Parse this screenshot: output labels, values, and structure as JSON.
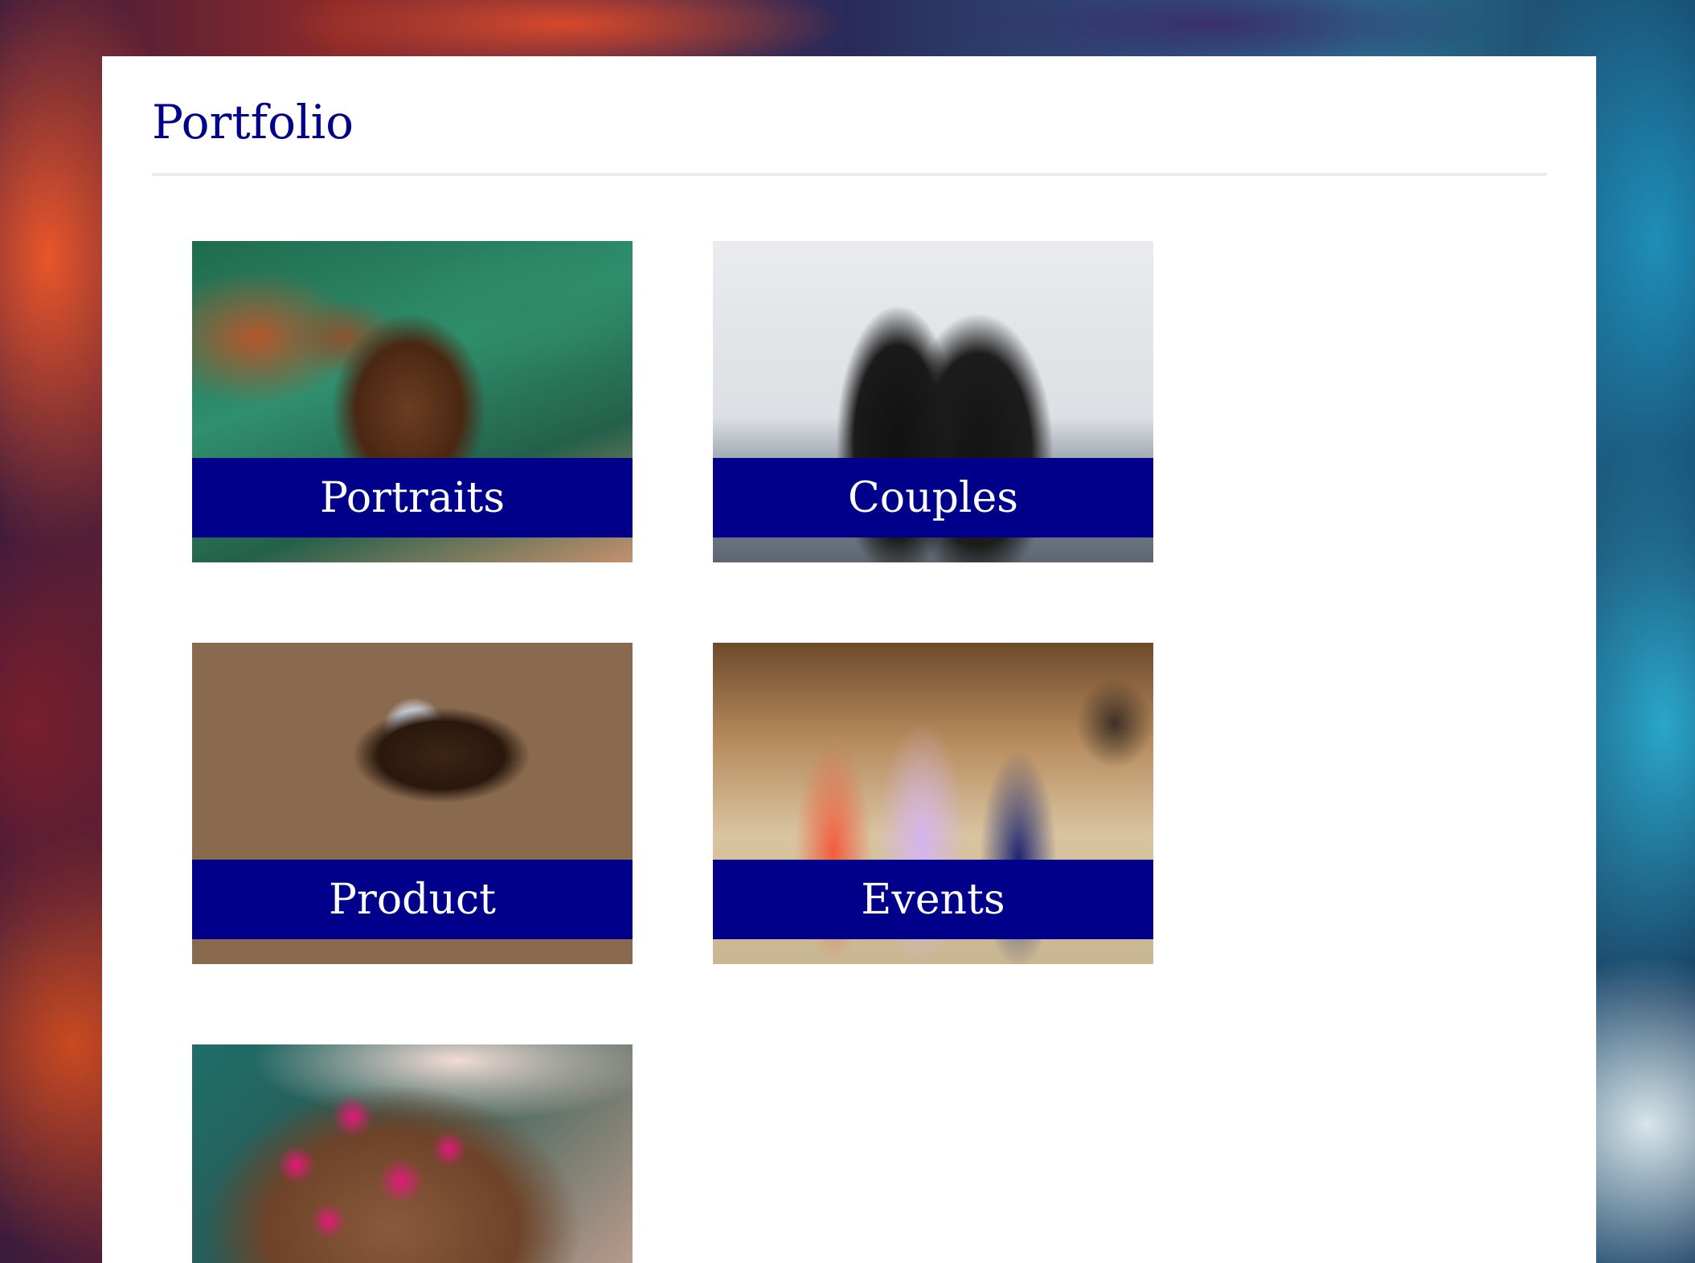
{
  "page": {
    "title": "Portfolio"
  },
  "gallery": {
    "tiles": [
      {
        "label": "Portraits",
        "photo": "portrait-photo"
      },
      {
        "label": "Couples",
        "photo": "couple-photo"
      },
      {
        "label": "Product",
        "photo": "product-photo"
      },
      {
        "label": "Events",
        "photo": "events-photo"
      },
      {
        "label": "",
        "photo": "maternity-photo"
      }
    ]
  },
  "colors": {
    "accent": "#00008b",
    "panel": "#ffffff",
    "divider": "#ececec"
  }
}
